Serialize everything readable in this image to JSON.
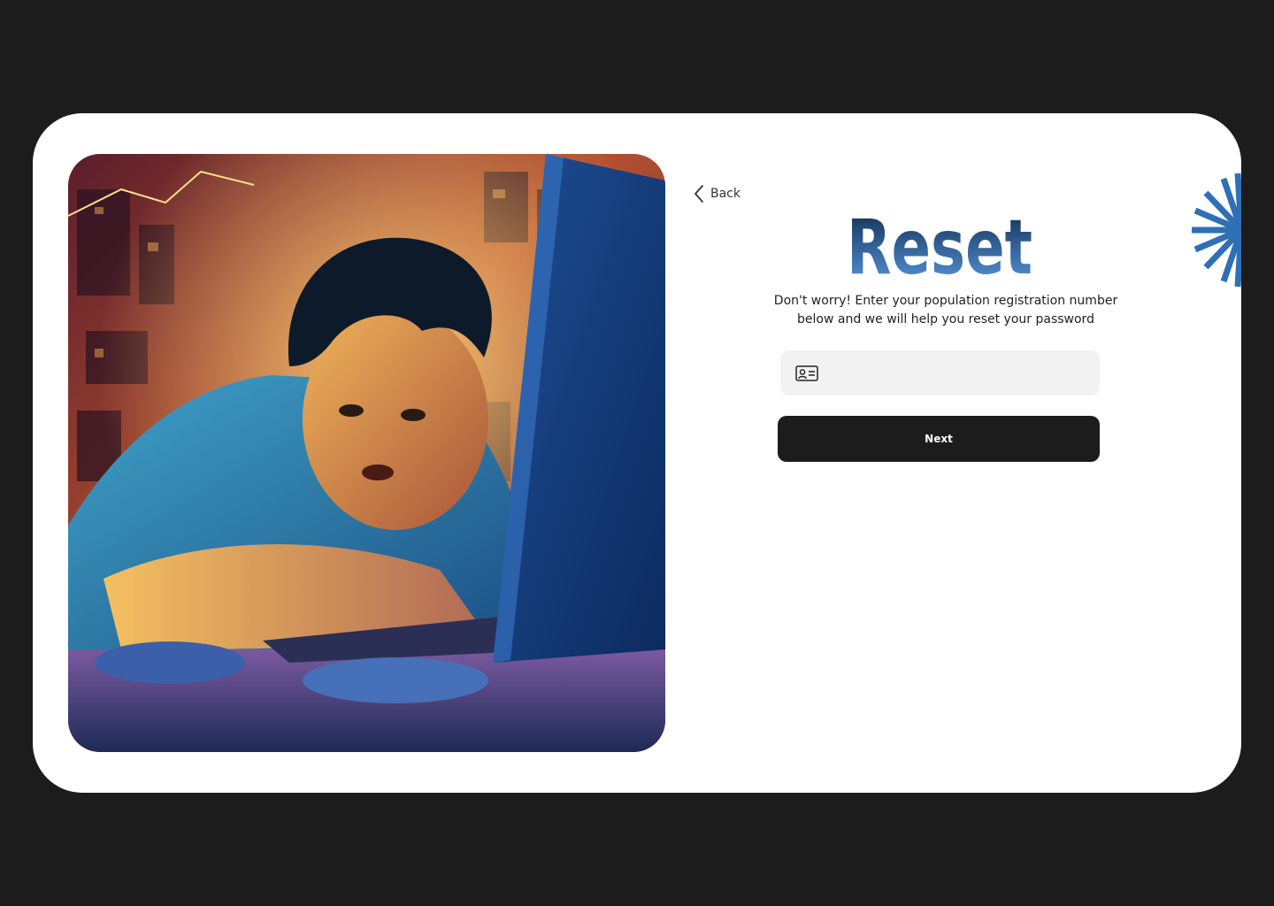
{
  "back": {
    "label": "Back"
  },
  "title": "Reset",
  "subtitle": {
    "line1": "Don't worry! Enter your population registration number",
    "line2": "below and we will help you reset your password"
  },
  "input": {
    "value": "",
    "placeholder": ""
  },
  "next_button": {
    "label": "Next"
  },
  "colors": {
    "page_background": "#1c1c1c",
    "card": "#ffffff",
    "accent_blue": "#2f6fb5",
    "title_top": "#0e2a4a",
    "title_bottom": "#5b9be6",
    "button": "#1c1c1c",
    "input_background": "#f2f2f2"
  },
  "icons": {
    "back": "chevron-left-icon",
    "input": "id-card-icon",
    "decor": "sunburst-icon"
  },
  "hero_image": {
    "description_tag": "illustration"
  }
}
